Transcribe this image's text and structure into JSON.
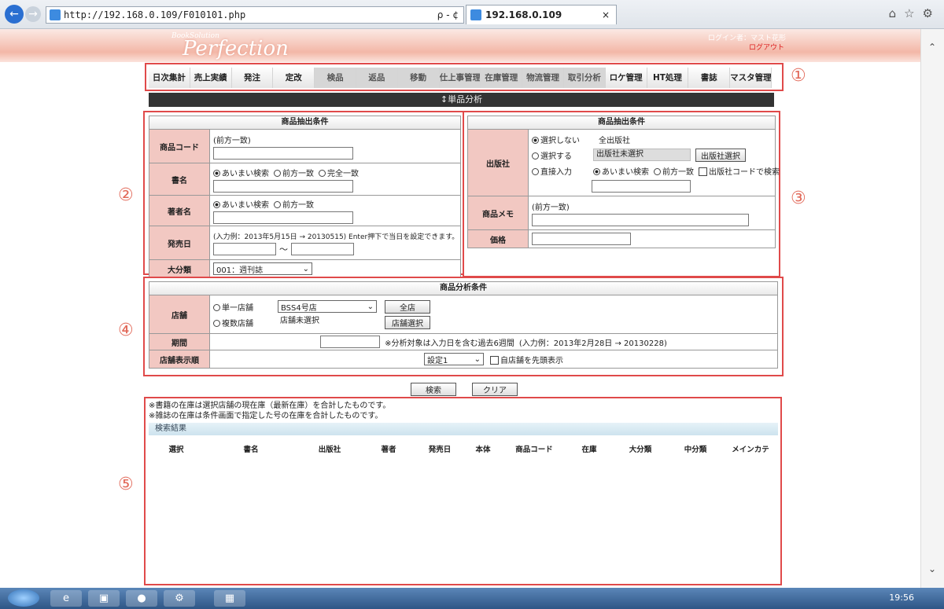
{
  "browser": {
    "url": "http://192.168.0.109/F010101.php",
    "addr_controls": "ρ - ¢",
    "tab_title": "192.168.0.109",
    "tab_close": "×",
    "icons": [
      "home-icon",
      "star-icon",
      "gear-icon"
    ]
  },
  "header": {
    "logo_small": "BookSolution",
    "logo": "Perfection",
    "login_line1": "ログイン者：マスト花形",
    "login_line2": "ログアウト"
  },
  "menu": {
    "items": [
      {
        "label": "日次集計",
        "dim": false
      },
      {
        "label": "売上実績",
        "dim": false
      },
      {
        "label": "発注",
        "dim": false
      },
      {
        "label": "定改",
        "dim": false
      },
      {
        "label": "検品",
        "dim": true
      },
      {
        "label": "返品",
        "dim": true
      },
      {
        "label": "移動",
        "dim": true
      },
      {
        "label": "仕上事管理",
        "dim": true
      },
      {
        "label": "在庫管理",
        "dim": true
      },
      {
        "label": "物流管理",
        "dim": true
      },
      {
        "label": "取引分析",
        "dim": true
      },
      {
        "label": "ロケ管理",
        "dim": false
      },
      {
        "label": "HT処理",
        "dim": false
      },
      {
        "label": "書誌",
        "dim": false
      },
      {
        "label": "マスタ管理",
        "dim": false
      }
    ]
  },
  "page_title": "単品分析",
  "annotations": [
    "①",
    "②",
    "③",
    "④",
    "⑤"
  ],
  "left_panel": {
    "title": "商品抽出条件",
    "code_label": "商品コード",
    "code_hint": "(前方一致)",
    "title_label": "書名",
    "title_radios": [
      "あいまい検索",
      "前方一致",
      "完全一致"
    ],
    "author_label": "著者名",
    "author_radios": [
      "あいまい検索",
      "前方一致"
    ],
    "date_label": "発売日",
    "date_hint": "(入力例：2013年5月15日 → 20130515) Enter押下で当日を設定できます。",
    "date_sep": "～",
    "category_label": "大分類",
    "category_value": "001：週刊誌"
  },
  "right_panel": {
    "title": "商品抽出条件",
    "publisher_label": "出版社",
    "pub_opt1": "選択しない",
    "pub_opt1_note": "全出版社",
    "pub_opt2": "選択する",
    "pub_unselected": "出版社未選択",
    "pub_select_btn": "出版社選択",
    "pub_opt3": "直接入力",
    "pub_radios": [
      "あいまい検索",
      "前方一致"
    ],
    "pub_code_check": "出版社コードで検索",
    "memo_label": "商品メモ",
    "memo_hint": "(前方一致)",
    "price_label": "価格"
  },
  "analysis": {
    "title": "商品分析条件",
    "store_label": "店舗",
    "single_store": "単一店舗",
    "store_value": "BSS4号店",
    "all_stores_btn": "全店",
    "multi_store": "複数店舗",
    "multi_unselected": "店舗未選択",
    "store_select_btn": "店舗選択",
    "period_label": "期間",
    "period_hint": "※分析対象は入力日を含む過去6週間",
    "period_example": "(入力例：2013年2月28日 → 20130228)",
    "display_label": "店舗表示順",
    "display_value": "設定1",
    "own_first": "自店舗を先頭表示"
  },
  "actions": {
    "search": "検索",
    "clear": "クリア"
  },
  "results": {
    "note1": "※書籍の在庫は選択店舗の現在庫（最新在庫）を合計したものです。",
    "note2": "※雑誌の在庫は条件画面で指定した号の在庫を合計したものです。",
    "title": "検索結果",
    "columns": [
      "選択",
      "書名",
      "出版社",
      "著者",
      "発売日",
      "本体",
      "商品コード",
      "在庫",
      "大分類",
      "中分類",
      "メインカテ"
    ]
  },
  "taskbar": {
    "clock": "19:56"
  }
}
